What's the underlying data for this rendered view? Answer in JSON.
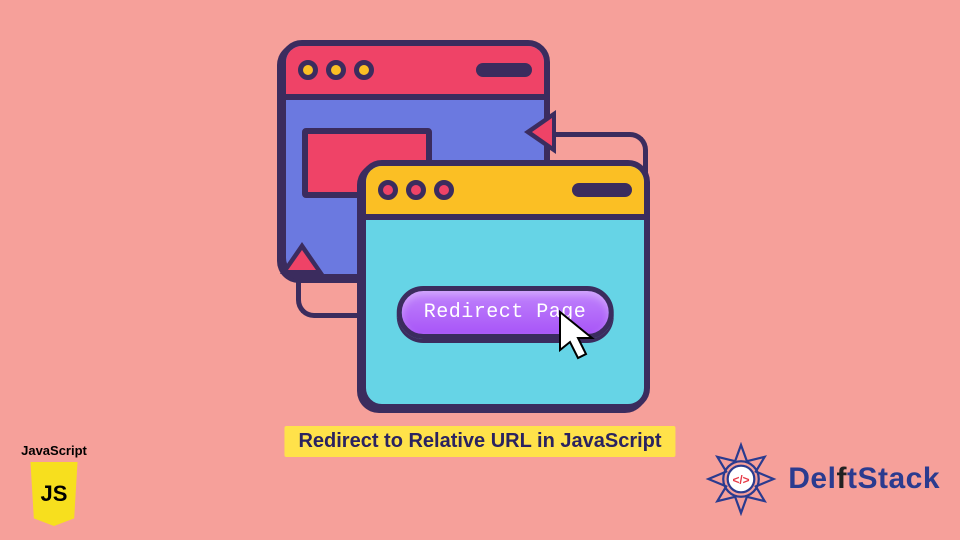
{
  "caption": "Redirect to Relative URL in JavaScript",
  "button_label": "Redirect Page",
  "js_badge": {
    "label": "JavaScript",
    "shield_text": "JS"
  },
  "brand": {
    "name": "DelftStack",
    "code_glyph": "</>"
  }
}
